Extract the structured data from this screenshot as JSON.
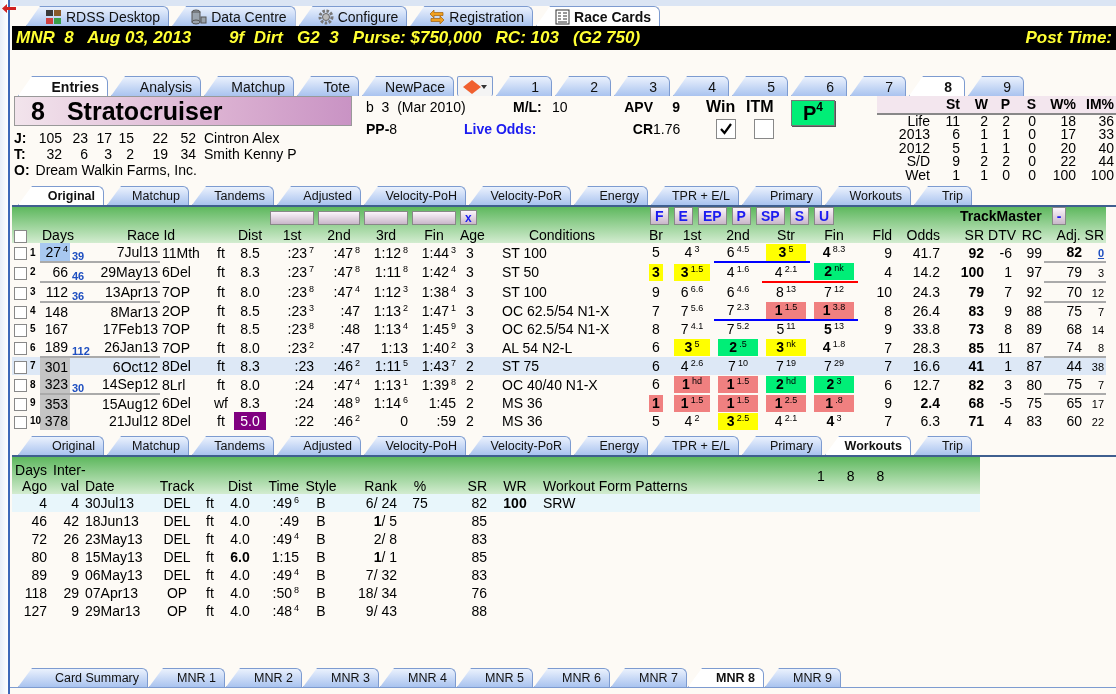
{
  "top_tabs": [
    {
      "label": "RDSS Desktop",
      "kind": "tiles",
      "selected": false
    },
    {
      "label": "Data Centre",
      "kind": "database",
      "selected": false
    },
    {
      "label": "Configure",
      "kind": "gear",
      "selected": false
    },
    {
      "label": "Registration",
      "kind": "swap",
      "selected": false
    },
    {
      "label": "Race Cards",
      "kind": "document",
      "selected": true
    }
  ],
  "header_bar": {
    "race": "MNR  8   Aug 03, 2013",
    "conditions": "9f  Dirt   G2  3   Purse: $750,000   RC: 103   (G2 750)",
    "post_time": "Post Time:"
  },
  "view_tabs": [
    {
      "label": "Entries",
      "selected": true
    },
    {
      "label": "Analysis",
      "selected": false
    },
    {
      "label": "Matchup",
      "selected": false
    },
    {
      "label": "Tote",
      "selected": false
    },
    {
      "label": "NewPace",
      "selected": false
    }
  ],
  "race_tabs": [
    {
      "label": "1",
      "selected": false
    },
    {
      "label": "2",
      "selected": false
    },
    {
      "label": "3",
      "selected": false
    },
    {
      "label": "4",
      "selected": false
    },
    {
      "label": "5",
      "selected": false
    },
    {
      "label": "6",
      "selected": false
    },
    {
      "label": "7",
      "selected": false
    },
    {
      "label": "8",
      "selected": true
    },
    {
      "label": "9",
      "selected": false
    }
  ],
  "horse": {
    "number": "8",
    "name": "Stratocruiser",
    "breeding": "b  3  (Mar 2010)",
    "post_position": "**PP-**8",
    "ml_label": "M/L:",
    "ml": "10",
    "live_odds_label": "Live Odds:",
    "apv_label": "APV",
    "apv": "9",
    "cr_label": "CR",
    "cr": "1.76",
    "win_label": "Win",
    "win_checked": true,
    "itm_label": "ITM",
    "itm_checked": false,
    "pace_badge": "P$^{4}$"
  },
  "connections": [
    {
      "label": "J:",
      "stats": [
        "105",
        "23",
        "17",
        "15",
        "22",
        "52"
      ],
      "name": "Cintron Alex"
    },
    {
      "label": "T:",
      "stats": [
        "32",
        "6",
        "3",
        "2",
        "19",
        "34"
      ],
      "name": "Smith Kenny P"
    }
  ],
  "owner": {
    "label": "O:",
    "name": "Dream Walkin Farms, Inc."
  },
  "record": {
    "columns": [
      "St",
      "W",
      "P",
      "S",
      "W%",
      "IM%"
    ],
    "rows": [
      {
        "label": "Life",
        "values": [
          "11",
          "2",
          "2",
          "0",
          "18",
          "36"
        ]
      },
      {
        "label": "2013",
        "values": [
          "6",
          "1",
          "1",
          "0",
          "17",
          "33"
        ]
      },
      {
        "label": "2012",
        "values": [
          "5",
          "1",
          "1",
          "0",
          "20",
          "40"
        ]
      },
      {
        "label": "S/D",
        "values": [
          "9",
          "2",
          "2",
          "0",
          "22",
          "44"
        ]
      },
      {
        "label": "Wet",
        "values": [
          "1",
          "1",
          "0",
          "0",
          "100",
          "100"
        ]
      }
    ]
  },
  "pp_tabs": [
    {
      "label": "Original",
      "selected": true
    },
    {
      "label": "Matchup",
      "selected": false
    },
    {
      "label": "Tandems",
      "selected": false
    },
    {
      "label": "Adjusted",
      "selected": false
    },
    {
      "label": "Velocity-PoH",
      "selected": false
    },
    {
      "label": "Velocity-PoR",
      "selected": false
    },
    {
      "label": "Energy",
      "selected": false
    },
    {
      "label": "TPR + E/L",
      "selected": false
    },
    {
      "label": "Primary",
      "selected": false
    },
    {
      "label": "Workouts",
      "selected": false
    },
    {
      "label": "Trip",
      "selected": false
    }
  ],
  "pp_table": {
    "close_button": "x",
    "pace_buttons": [
      "F",
      "E",
      "EP",
      "P",
      "SP",
      "S",
      "U"
    ],
    "trackmaster": "TrackMaster",
    "collapse_button": "-",
    "select_all_checked": false,
    "columns": [
      "Days",
      "Race Id",
      "Dist",
      "1st",
      "2nd",
      "3rd",
      "Fin",
      "Age",
      "Conditions",
      "Br",
      "1st",
      "2nd",
      "Str",
      "Fin",
      "Fld",
      "Odds",
      "SR",
      "DTV",
      "RC",
      "Adj. SR"
    ],
    "rows": [
      {
        "num": "1",
        "days": "27$^{4}$",
        "gap": "39",
        "days_mark": {
          "color": "#a8c8f0"
        },
        "date": "7Jul13",
        "race": "11Mth",
        "surface": "ft",
        "dist": "8.5",
        "fractions": [
          ":23$^{7}$",
          ":47$^{8}$",
          "1:12$^{8}$",
          "1:44$^{3}$"
        ],
        "age": "3",
        "conditions": "ST 100",
        "calls": [
          {
            "text": "5"
          },
          {
            "text": "4$^{3}$"
          },
          {
            "text": "6$^{4.5}$",
            "underline": {
              "color": "#0000ff"
            }
          },
          {
            "text": "**3**$^{5}$",
            "color": "#ffff00",
            "underline": {
              "color": "#0000ff"
            }
          },
          {
            "text": "**4**$^{8.3}$"
          }
        ],
        "fld": "9",
        "odds": "41.7",
        "sr": "92",
        "dtv": "-6",
        "rc": "99",
        "adj_sr": "**82**",
        "adj_note": "0",
        "adj_note_linked": true,
        "checked": false,
        "selected": false
      },
      {
        "num": "2",
        "days": "66",
        "gap": "46",
        "date": "29May13",
        "race": "6Del",
        "surface": "ft",
        "dist": "8.3",
        "fractions": [
          ":23$^{7}$",
          ":47$^{8}$",
          "1:11$^{8}$",
          "1:42$^{4}$"
        ],
        "age": "3",
        "conditions": "ST 50",
        "calls": [
          {
            "text": "**3**",
            "color": "#ffff00"
          },
          {
            "text": "**3**$^{1.5}$",
            "color": "#ffff00"
          },
          {
            "text": "4$^{1.6}$"
          },
          {
            "text": "4$^{2.1}$",
            "underline": {
              "color": "#ff0000"
            }
          },
          {
            "text": "**2**$^{nk}$",
            "color": "#00ee77",
            "underline": {
              "color": "#ff0000"
            }
          }
        ],
        "fld": "4",
        "odds": "14.2",
        "sr": "100",
        "dtv": "1",
        "rc": "97",
        "adj_sr": "79",
        "adj_note": "3",
        "adj_note_linked": false,
        "checked": false,
        "selected": false
      },
      {
        "num": "3",
        "days": "112",
        "gap": "36",
        "date": "13Apr13",
        "race": "7OP",
        "surface": "ft",
        "dist": "8.0",
        "fractions": [
          ":23$^{8}$",
          ":47$^{4}$",
          "1:12$^{3}$",
          "1:38$^{4}$"
        ],
        "age": "3",
        "conditions": "ST 100",
        "calls": [
          {
            "text": "9"
          },
          {
            "text": "6$^{6.6}$"
          },
          {
            "text": "6$^{4.6}$"
          },
          {
            "text": "8$^{13}$"
          },
          {
            "text": "7$^{12}$"
          }
        ],
        "fld": "10",
        "odds": "24.3",
        "sr": "79",
        "dtv": "7",
        "rc": "92",
        "adj_sr": "70",
        "adj_note": "12",
        "adj_note_linked": false,
        "checked": false,
        "selected": false
      },
      {
        "num": "4",
        "days": "148",
        "date": "8Mar13",
        "race": "2OP",
        "surface": "ft",
        "dist": "8.5",
        "fractions": [
          ":23$^{3}$",
          ":47",
          "1:13$^{2}$",
          "1:47$^{1}$"
        ],
        "age": "3",
        "conditions": "OC 62.5/54 N1-X",
        "calls": [
          {
            "text": "7"
          },
          {
            "text": "7$^{5.6}$"
          },
          {
            "text": "7$^{2.3}$",
            "underline": {
              "color": "#0000ff"
            }
          },
          {
            "text": "**1**$^{1.5}$",
            "color": "#f08080",
            "underline": {
              "color": "#0000ff"
            }
          },
          {
            "text": "**1**$^{3.8}$",
            "color": "#f08080",
            "underline": {
              "color": "#0000ff"
            }
          }
        ],
        "fld": "8",
        "odds": "26.4",
        "sr": "83",
        "dtv": "9",
        "rc": "88",
        "adj_sr": "75",
        "adj_note": "7",
        "adj_note_linked": false,
        "checked": false,
        "selected": false
      },
      {
        "num": "5",
        "days": "167",
        "date": "17Feb13",
        "race": "7OP",
        "surface": "ft",
        "dist": "8.5",
        "fractions": [
          ":23$^{8}$",
          ":48",
          "1:13$^{4}$",
          "1:45$^{9}$"
        ],
        "age": "3",
        "conditions": "OC 62.5/54 N1-X",
        "calls": [
          {
            "text": "8"
          },
          {
            "text": "7$^{4.1}$"
          },
          {
            "text": "7$^{5.2}$"
          },
          {
            "text": "5$^{11}$"
          },
          {
            "text": "**5**$^{13}$"
          }
        ],
        "fld": "9",
        "odds": "33.8",
        "sr": "73",
        "dtv": "8",
        "rc": "89",
        "adj_sr": "68",
        "adj_note": "14",
        "adj_note_linked": false,
        "checked": false,
        "selected": false
      },
      {
        "num": "6",
        "days": "189",
        "gap": "112",
        "date": "26Jan13",
        "race": "7OP",
        "surface": "ft",
        "dist": "8.0",
        "fractions": [
          ":23$^{2}$",
          ":47",
          "1:13",
          "1:40$^{2}$"
        ],
        "age": "3",
        "conditions": "AL 54 N2-L",
        "calls": [
          {
            "text": "6"
          },
          {
            "text": "**3**$^{5}$",
            "color": "#ffff00"
          },
          {
            "text": "**2**$^{.5}$",
            "color": "#00ee77"
          },
          {
            "text": "**3**$^{nk}$",
            "color": "#ffff00"
          },
          {
            "text": "**4**$^{1.8}$"
          }
        ],
        "fld": "7",
        "odds": "28.3",
        "sr": "85",
        "dtv": "11",
        "rc": "87",
        "adj_sr": "74",
        "adj_note": "8",
        "adj_note_linked": false,
        "checked": false,
        "selected": false
      },
      {
        "num": "7",
        "days": "301",
        "days_mark": {
          "color": "#c4c4c4"
        },
        "date": "6Oct12",
        "race": "8Del",
        "surface": "ft",
        "dist": "8.3",
        "fractions": [
          ":23",
          ":46$^{2}$",
          "1:11$^{5}$",
          "1:43$^{7}$"
        ],
        "age": "2",
        "conditions": "ST 75",
        "calls": [
          {
            "text": "6"
          },
          {
            "text": "4$^{2.6}$"
          },
          {
            "text": "7$^{10}$"
          },
          {
            "text": "7$^{19}$"
          },
          {
            "text": "7$^{29}$"
          }
        ],
        "fld": "7",
        "odds": "16.6",
        "sr": "41",
        "dtv": "1",
        "rc": "87",
        "adj_sr": "44",
        "adj_note": "38",
        "adj_note_linked": false,
        "checked": false,
        "selected": true
      },
      {
        "num": "8",
        "days": "323",
        "gap": "30",
        "days_mark": {
          "color": "#c4c4c4"
        },
        "date": "14Sep12",
        "race": "8Lrl",
        "surface": "ft",
        "dist": "8.0",
        "fractions": [
          ":24",
          ":47$^{4}$",
          "1:13$^{1}$",
          "1:39$^{8}$"
        ],
        "age": "2",
        "conditions": "OC 40/40 N1-X",
        "calls": [
          {
            "text": "6"
          },
          {
            "text": "**1**$^{hd}$",
            "color": "#f08080"
          },
          {
            "text": "**1**$^{1.5}$",
            "color": "#f08080"
          },
          {
            "text": "**2**$^{hd}$",
            "color": "#00ee77"
          },
          {
            "text": "**2**$^{3}$",
            "color": "#00ee77"
          }
        ],
        "fld": "6",
        "odds": "12.7",
        "sr": "82",
        "dtv": "3",
        "rc": "80",
        "adj_sr": "75",
        "adj_note": "7",
        "adj_note_linked": false,
        "checked": false,
        "selected": false
      },
      {
        "num": "9",
        "days": "353",
        "days_mark": {
          "color": "#c4c4c4"
        },
        "date": "15Aug12",
        "race": "6Del",
        "surface": "wf",
        "dist": "8.3",
        "fractions": [
          ":24",
          ":48$^{9}$",
          "1:14$^{6}$",
          "1:45"
        ],
        "age": "2",
        "conditions": "MS 36",
        "calls": [
          {
            "text": "**1**",
            "color": "#f08080"
          },
          {
            "text": "**1**$^{1.5}$",
            "color": "#f08080"
          },
          {
            "text": "**1**$^{1.5}$",
            "color": "#f08080"
          },
          {
            "text": "**1**$^{2.5}$",
            "color": "#f08080"
          },
          {
            "text": "**1**$^{.8}$",
            "color": "#f08080"
          }
        ],
        "fld": "9",
        "odds": "**2.4**",
        "sr": "68",
        "dtv": "-5",
        "rc": "75",
        "adj_sr": "65",
        "adj_note": "17",
        "adj_note_linked": false,
        "checked": false,
        "selected": false
      },
      {
        "num": "10",
        "days": "378",
        "days_mark": {
          "color": "#c4c4c4"
        },
        "date": "21Jul12",
        "race": "8Del",
        "surface": "ft",
        "dist": "5.0",
        "dist_mark": {
          "color": "#800080"
        },
        "fractions": [
          ":22",
          ":46$^{2}$",
          "0",
          ":59"
        ],
        "age": "2",
        "conditions": "MS 36",
        "calls": [
          {
            "text": "5"
          },
          {
            "text": "4$^{2}$"
          },
          {
            "text": "**3**$^{2.5}$",
            "color": "#ffff00"
          },
          {
            "text": "4$^{2.1}$"
          },
          {
            "text": "**4**$^{3}$"
          }
        ],
        "fld": "7",
        "odds": "6.3",
        "sr": "71",
        "dtv": "4",
        "rc": "83",
        "adj_sr": "60",
        "adj_note": "22",
        "adj_note_linked": false,
        "checked": false,
        "selected": false
      }
    ]
  },
  "workout_tabs": [
    {
      "label": "Original",
      "selected": false
    },
    {
      "label": "Matchup",
      "selected": false
    },
    {
      "label": "Tandems",
      "selected": false
    },
    {
      "label": "Adjusted",
      "selected": false
    },
    {
      "label": "Velocity-PoH",
      "selected": false
    },
    {
      "label": "Velocity-PoR",
      "selected": false
    },
    {
      "label": "Energy",
      "selected": false
    },
    {
      "label": "TPR + E/L",
      "selected": false
    },
    {
      "label": "Primary",
      "selected": false
    },
    {
      "label": "Workouts",
      "selected": true
    },
    {
      "label": "Trip",
      "selected": false
    }
  ],
  "workouts": {
    "columns": [
      "Days\nAgo",
      "Inter-\nval",
      "Date",
      "Track",
      "Dist",
      "Time",
      "Style",
      "Rank",
      "%",
      "SR",
      "WR",
      "Workout Form Patterns"
    ],
    "pattern_counts": [
      "1",
      "8",
      "8"
    ],
    "rows": [
      {
        "days_ago": "4",
        "interval": "4",
        "date": "30Jul13",
        "track": "DEL",
        "surface": "ft",
        "dist": "4.0",
        "time": ":49$^{6}$",
        "style": "B",
        "rank": "6/ 24",
        "pct": "75",
        "sr": "82",
        "wr": "100",
        "pattern": "SRW",
        "selected": true
      },
      {
        "days_ago": "46",
        "interval": "42",
        "date": "18Jun13",
        "track": "DEL",
        "surface": "ft",
        "dist": "4.0",
        "time": ":49",
        "style": "B",
        "rank": "**1**/ 5",
        "sr": "85",
        "selected": false
      },
      {
        "days_ago": "72",
        "interval": "26",
        "date": "23May13",
        "track": "DEL",
        "surface": "ft",
        "dist": "4.0",
        "time": ":49$^{4}$",
        "style": "B",
        "rank": "2/ 8",
        "sr": "83",
        "selected": false
      },
      {
        "days_ago": "80",
        "interval": "8",
        "date": "15May13",
        "track": "DEL",
        "surface": "ft",
        "dist": "**6.0**",
        "time": "1:15",
        "style": "B",
        "rank": "**1**/ 1",
        "sr": "85",
        "selected": false
      },
      {
        "days_ago": "89",
        "interval": "9",
        "date": "06May13",
        "track": "DEL",
        "surface": "ft",
        "dist": "4.0",
        "time": ":49$^{4}$",
        "style": "B",
        "rank": "7/ 32",
        "sr": "83",
        "selected": false
      },
      {
        "days_ago": "118",
        "interval": "29",
        "date": "07Apr13",
        "track": "OP",
        "surface": "ft",
        "dist": "4.0",
        "time": ":50$^{8}$",
        "style": "B",
        "rank": "18/ 34",
        "sr": "76",
        "selected": false
      },
      {
        "days_ago": "127",
        "interval": "9",
        "date": "29Mar13",
        "track": "OP",
        "surface": "ft",
        "dist": "4.0",
        "time": ":48$^{4}$",
        "style": "B",
        "rank": "9/ 43",
        "sr": "88",
        "selected": false
      }
    ]
  },
  "bottom_tabs": [
    {
      "label": "Card Summary",
      "selected": false
    },
    {
      "label": "MNR 1",
      "selected": false
    },
    {
      "label": "MNR 2",
      "selected": false
    },
    {
      "label": "MNR 3",
      "selected": false
    },
    {
      "label": "MNR 4",
      "selected": false
    },
    {
      "label": "MNR 5",
      "selected": false
    },
    {
      "label": "MNR 6",
      "selected": false
    },
    {
      "label": "MNR 7",
      "selected": false
    },
    {
      "label": "MNR 8",
      "selected": true
    },
    {
      "label": "MNR 9",
      "selected": false
    }
  ]
}
